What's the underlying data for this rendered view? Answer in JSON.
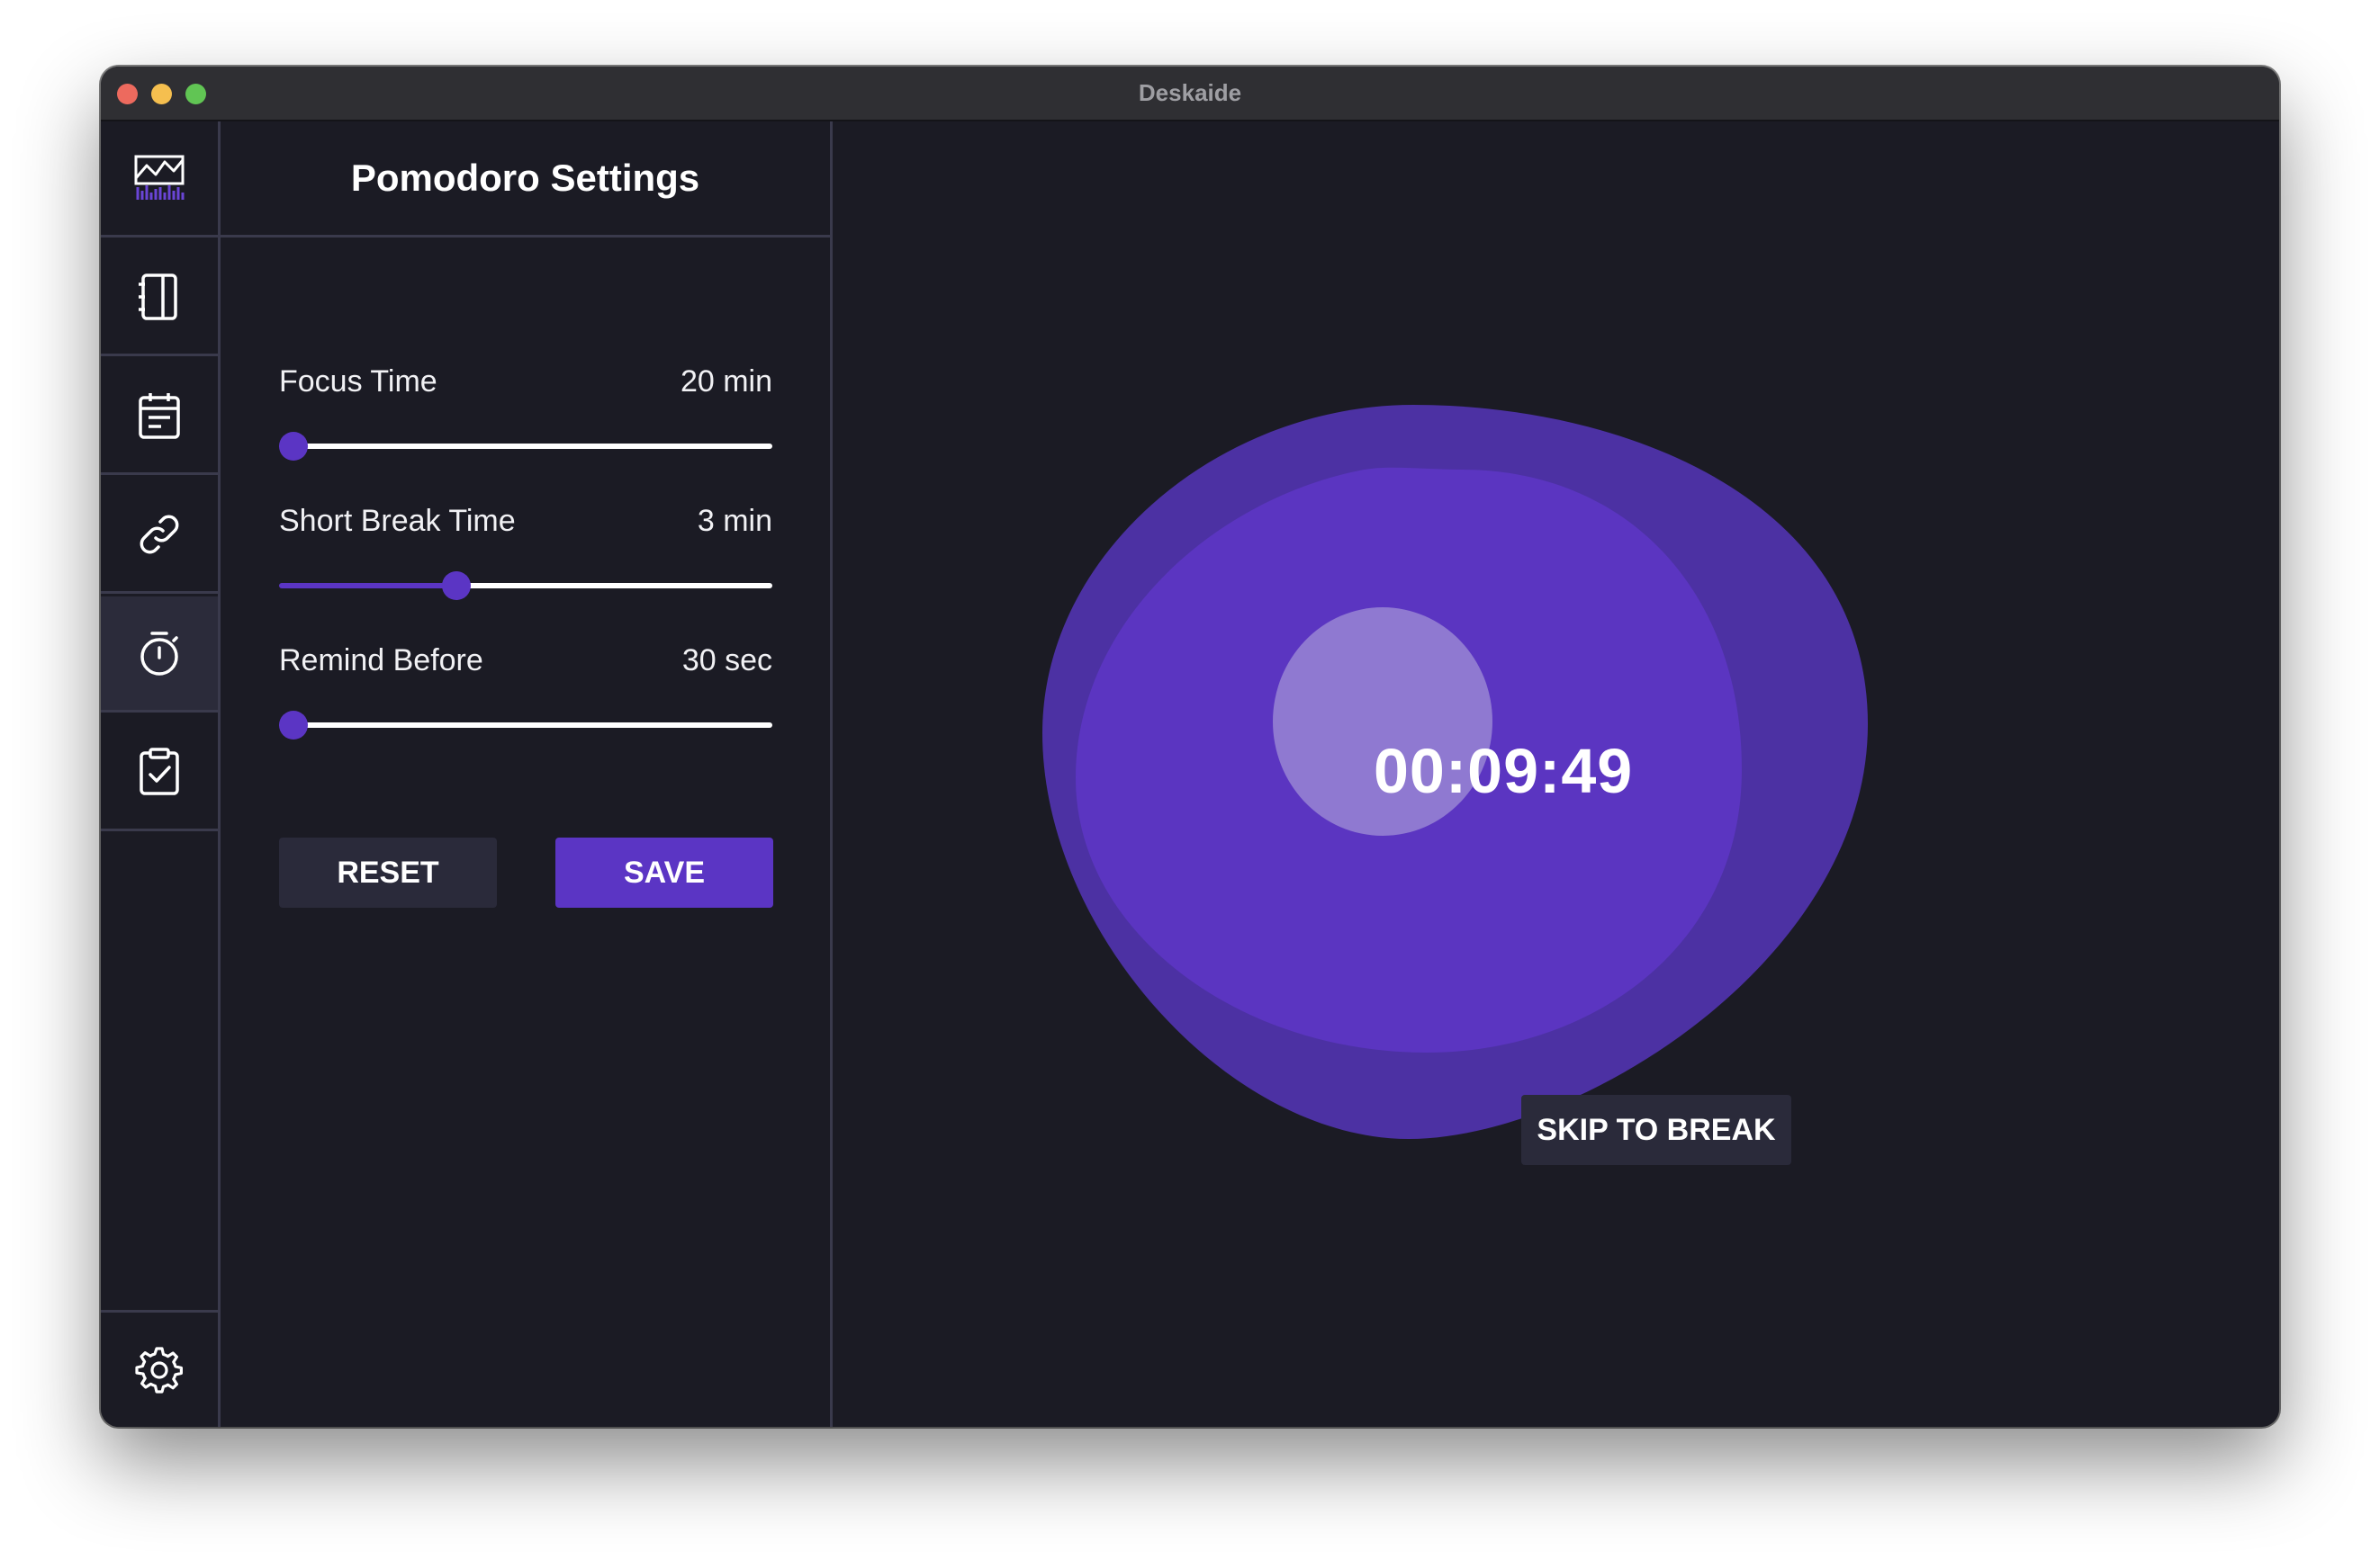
{
  "window": {
    "title": "Deskaide"
  },
  "sidebar": {
    "items": [
      {
        "icon": "analytics-icon",
        "active": false
      },
      {
        "icon": "notebook-icon",
        "active": false
      },
      {
        "icon": "calendar-icon",
        "active": false
      },
      {
        "icon": "link-icon",
        "active": false
      },
      {
        "icon": "stopwatch-icon",
        "active": true
      },
      {
        "icon": "clipboard-check-icon",
        "active": false
      }
    ],
    "bottom_icon": "gear-icon"
  },
  "panel": {
    "title": "Pomodoro Settings",
    "settings": [
      {
        "label": "Focus Time",
        "value": "20 min",
        "fraction": 0.0
      },
      {
        "label": "Short Break Time",
        "value": "3 min",
        "fraction": 0.34
      },
      {
        "label": "Remind Before",
        "value": "30 sec",
        "fraction": 0.0
      }
    ],
    "reset_label": "RESET",
    "save_label": "SAVE"
  },
  "timer": {
    "display": "00:09:49",
    "skip_label": "SKIP TO BREAK"
  },
  "colors": {
    "accent": "#5b35c4",
    "background": "#1b1b24",
    "blob_outer": "#4c31a3",
    "blob_middle": "#5b35c1",
    "blob_inner": "#8f79d1",
    "button_dark": "#2a2a3a"
  }
}
